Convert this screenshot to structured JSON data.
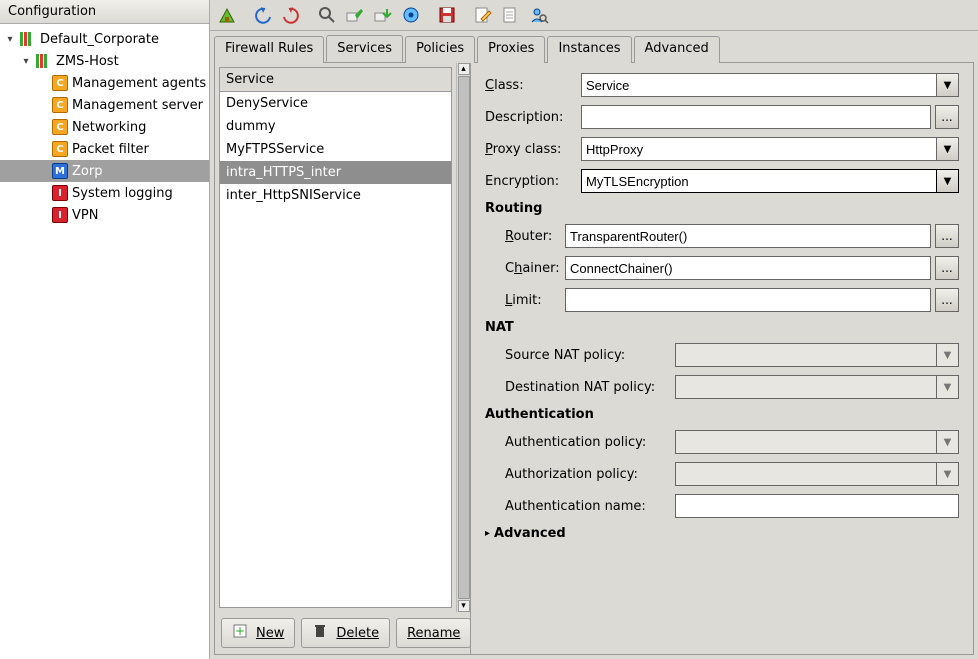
{
  "tree_title": "Configuration",
  "tree": {
    "root": "Default_Corporate",
    "host": "ZMS-Host",
    "items": [
      {
        "label": "Management agents",
        "icon": "orange"
      },
      {
        "label": "Management server",
        "icon": "orange"
      },
      {
        "label": "Networking",
        "icon": "orange"
      },
      {
        "label": "Packet filter",
        "icon": "orange"
      },
      {
        "label": "Zorp",
        "icon": "blue",
        "selected": true
      },
      {
        "label": "System logging",
        "icon": "red"
      },
      {
        "label": "VPN",
        "icon": "red"
      }
    ]
  },
  "tabs": [
    "Firewall Rules",
    "Services",
    "Policies",
    "Proxies",
    "Instances",
    "Advanced"
  ],
  "active_tab": 1,
  "service_header": "Service",
  "services": [
    {
      "name": "DenyService"
    },
    {
      "name": "dummy"
    },
    {
      "name": "MyFTPSService"
    },
    {
      "name": "intra_HTTPS_inter",
      "selected": true
    },
    {
      "name": "inter_HttpSNIService"
    }
  ],
  "buttons": {
    "new": "New",
    "delete": "Delete",
    "rename": "Rename"
  },
  "form": {
    "labels": {
      "class": "Class:",
      "description": "Description:",
      "proxy": "Proxy class:",
      "encryption": "Encryption:",
      "routing": "Routing",
      "router": "Router:",
      "chainer": "Chainer:",
      "limit": "Limit:",
      "nat": "NAT",
      "src_nat": "Source NAT policy:",
      "dst_nat": "Destination NAT policy:",
      "auth": "Authentication",
      "authn_pol": "Authentication policy:",
      "authz_pol": "Authorization policy:",
      "authn_name": "Authentication name:",
      "advanced": "Advanced"
    },
    "values": {
      "class": "Service",
      "description": "",
      "proxy": "HttpProxy",
      "encryption": "MyTLSEncryption",
      "router": "TransparentRouter()",
      "chainer": "ConnectChainer()",
      "limit": "",
      "src_nat": "",
      "dst_nat": "",
      "authn_pol": "",
      "authz_pol": "",
      "authn_name": ""
    }
  },
  "toolbar_icons": [
    "home-icon",
    "sep",
    "undo-icon",
    "redo-icon",
    "sep",
    "search-icon",
    "apply-icon",
    "receive-icon",
    "settings-icon",
    "sep",
    "disk-icon",
    "sep",
    "edit-icon",
    "doc-icon",
    "user-search-icon"
  ]
}
